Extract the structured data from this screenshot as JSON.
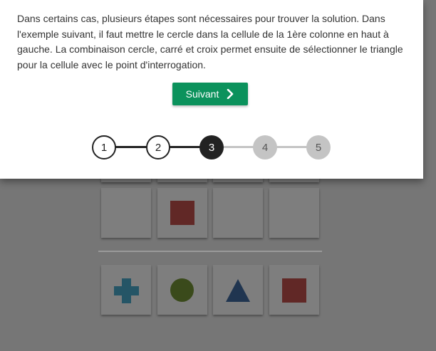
{
  "modal": {
    "text": "Dans certains cas, plusieurs étapes sont nécessaires pour trouver la solution. Dans l'exemple suivant, il faut mettre le cercle dans la cellule de la 1ère colonne en haut à gauche. La combinaison cercle, carré et croix permet ensuite de sélectionner le triangle pour la cellule avec le point d'interrogation.",
    "next_label": "Suivant",
    "next_icon": "chevron-right-icon"
  },
  "stepper": {
    "steps": [
      {
        "label": "1",
        "state": "done"
      },
      {
        "label": "2",
        "state": "done"
      },
      {
        "label": "3",
        "state": "active"
      },
      {
        "label": "4",
        "state": "todo"
      },
      {
        "label": "5",
        "state": "todo"
      }
    ]
  },
  "puzzle": {
    "grid_row_shapes": [
      "",
      "square",
      "",
      ""
    ],
    "options": [
      "cross",
      "circle",
      "triangle",
      "square"
    ]
  },
  "colors": {
    "accent": "#0b925c",
    "cross": "#1f86b6",
    "circle": "#5f8a0c",
    "triangle": "#0a4a86",
    "square": "#c42420",
    "step_active": "#222222",
    "step_todo": "#c4c4c4"
  }
}
